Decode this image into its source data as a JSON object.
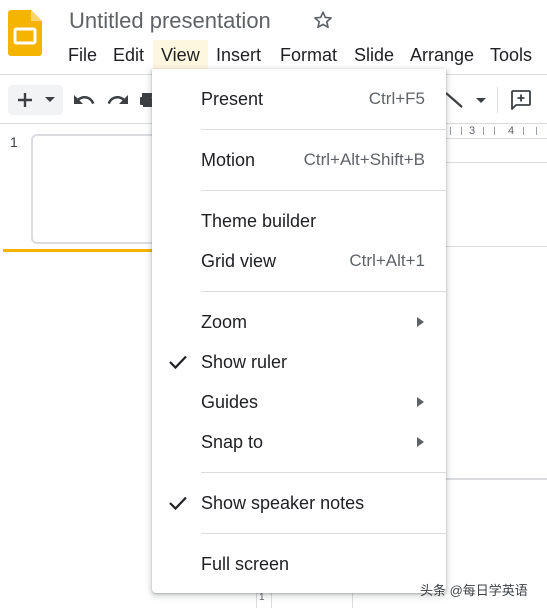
{
  "app": {
    "title": "Untitled presentation",
    "logo_icon": "google-slides-logo",
    "brand_color": "#f4b400"
  },
  "menubar": {
    "items": [
      {
        "label": "File"
      },
      {
        "label": "Edit"
      },
      {
        "label": "View",
        "active": true
      },
      {
        "label": "Insert"
      },
      {
        "label": "Format"
      },
      {
        "label": "Slide"
      },
      {
        "label": "Arrange"
      },
      {
        "label": "Tools"
      }
    ]
  },
  "toolbar": {
    "icons": [
      "add-icon",
      "chevron-down-icon",
      "undo-icon",
      "redo-icon",
      "print-icon",
      "line-icon",
      "chevron-down-icon",
      "add-comment-icon"
    ]
  },
  "ruler": {
    "labels": [
      "3",
      "4"
    ]
  },
  "filmstrip": {
    "slide_number": "1"
  },
  "vertical_ruler": {
    "label": "1"
  },
  "view_menu": {
    "items": [
      {
        "label": "Present",
        "shortcut": "Ctrl+F5"
      },
      {
        "label": "Motion",
        "shortcut": "Ctrl+Alt+Shift+B"
      },
      {
        "label": "Theme builder"
      },
      {
        "label": "Grid view",
        "shortcut": "Ctrl+Alt+1"
      },
      {
        "label": "Zoom",
        "submenu": true
      },
      {
        "label": "Show ruler",
        "checked": true
      },
      {
        "label": "Guides",
        "submenu": true
      },
      {
        "label": "Snap to",
        "submenu": true
      },
      {
        "label": "Show speaker notes",
        "checked": true
      },
      {
        "label": "Full screen"
      }
    ]
  },
  "watermark": {
    "text": "头条 @每日学英语"
  }
}
